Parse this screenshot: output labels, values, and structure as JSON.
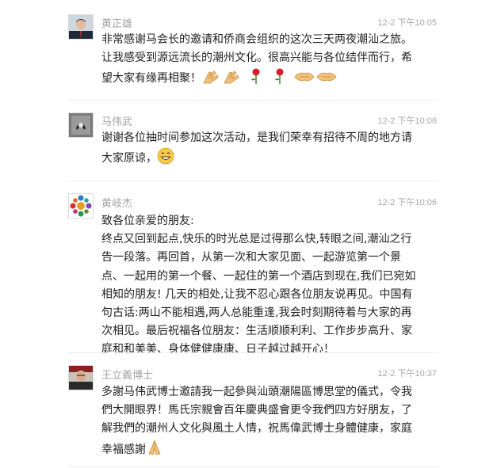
{
  "messages": [
    {
      "name": "黄正雄",
      "time": "12-2 下午10:05",
      "avatar_icon": "man-portrait-avatar",
      "text": "非常感谢马会长的邀请和侨商会组织的这次三天两夜潮汕之旅。让我感受到源远流长的潮州文化。很高兴能与各位结伴而行，希望大家有缘再相聚！",
      "emojis": [
        "clap-icon",
        "clap-icon",
        "rose-icon",
        "rose-icon",
        "handshake-icon",
        "handshake-icon"
      ]
    },
    {
      "name": "马伟武",
      "time": "12-2 下午10:06",
      "avatar_icon": "phone-headset-avatar",
      "text": "谢谢各位抽时间参加这次活动，是我们荣幸有招待不周的地方请大家原谅，",
      "emojis": [
        "smile-icon"
      ]
    },
    {
      "name": "黄岐杰",
      "time": "12-2 下午10:06",
      "avatar_icon": "flower-mandala-avatar",
      "text": "致各位亲爱的朋友:\n终点又回到起点,快乐的时光总是过得那么快,转眼之间,潮汕之行告一段落。再回首，从第一次和大家见面、一起游览第一个景点、一起用的第一个餐、一起住的第一个酒店到现在,我们已宛如相知的朋友! 几天的相处,让我不忍心跟各位朋友说再见。中国有句古话:两山不能相遇,两人总能重逢,我会时刻期待着与大家的再次相见。最后祝福各位朋友：生活顺顺利利、工作步步高升、家庭和和美美、身体健健康康、日子越过越开心！",
      "emojis": []
    },
    {
      "name": "王立義博士",
      "time": "12-2 下午10:37",
      "avatar_icon": "man-portrait-avatar",
      "text": "多謝马伟武博士邀請我一起參與汕頭潮陽區博思堂的儀式，令我們大開眼界！馬氏宗親會百年慶典盛會更令我們四方好朋友，了解我們的潮州人文化與風土人情，祝馬偉武博士身體健康，家庭幸福感謝",
      "emojis": [
        "pray-icon"
      ]
    }
  ]
}
